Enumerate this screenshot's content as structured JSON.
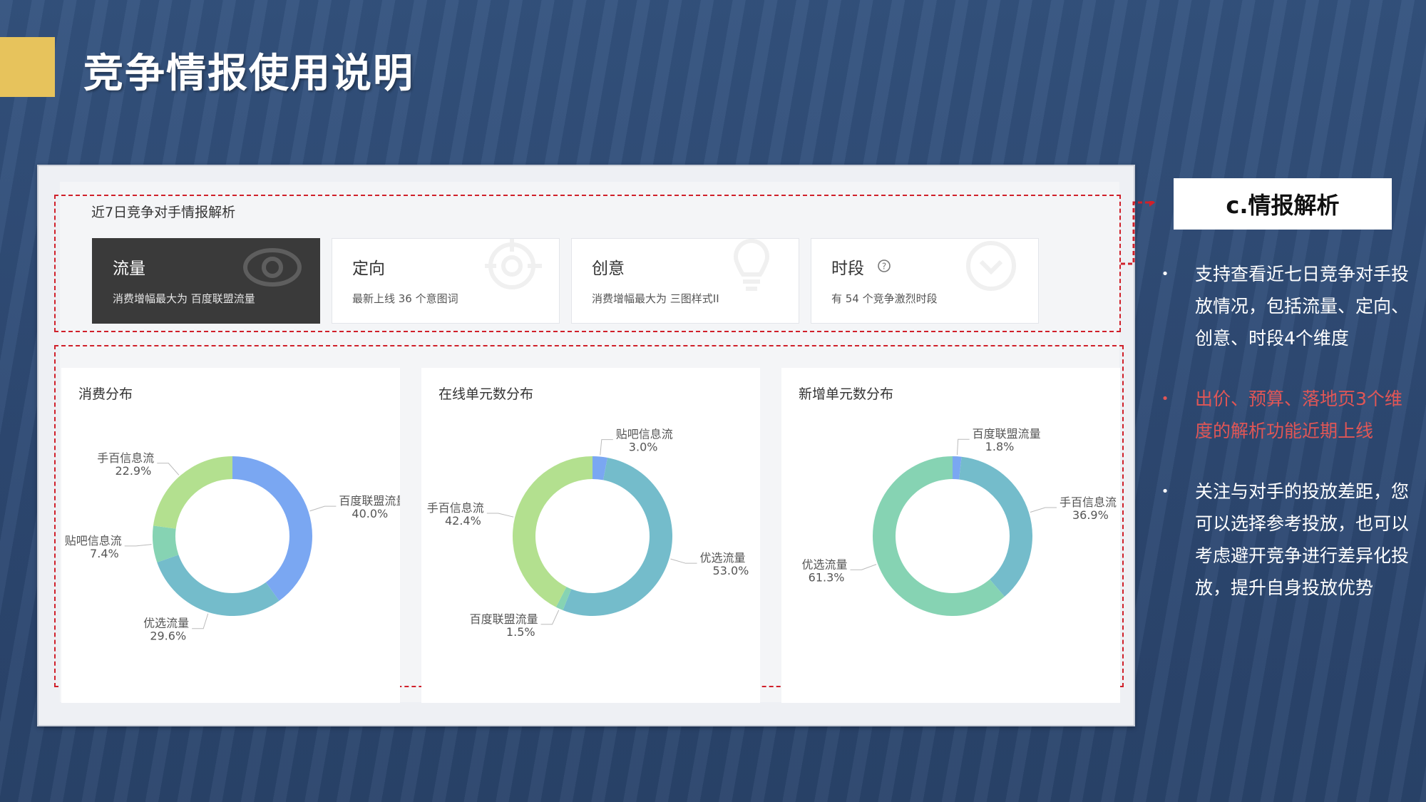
{
  "slide": {
    "title": "竞争情报使用说明",
    "accent_color": "#e7c35c",
    "background_color": "#2f4c78"
  },
  "panel": {
    "section_title": "近7日竞争对手情报解析",
    "highlight_color": "#d0202a",
    "tabs": [
      {
        "label": "流量",
        "desc": "消费增幅最大为 百度联盟流量",
        "active": true,
        "icon": "eye-icon"
      },
      {
        "label": "定向",
        "desc": "最新上线 36 个意图词",
        "active": false,
        "icon": "target-icon"
      },
      {
        "label": "创意",
        "desc": "消费增幅最大为 三图样式II",
        "active": false,
        "icon": "lightbulb-icon"
      },
      {
        "label": "时段",
        "desc": "有 54 个竞争激烈时段",
        "active": false,
        "icon": "clock-icon",
        "help_icon": "question-circle-icon"
      }
    ]
  },
  "chart_data": [
    {
      "type": "pie",
      "title": "消费分布",
      "slices": [
        {
          "label": "百度联盟流量",
          "value": 40.0,
          "text": "40.0%",
          "color": "#7aa7f2"
        },
        {
          "label": "优选流量",
          "value": 29.6,
          "text": "29.6%",
          "color": "#74bccb"
        },
        {
          "label": "贴吧信息流",
          "value": 7.4,
          "text": "7.4%",
          "color": "#86d3b3"
        },
        {
          "label": "手百信息流",
          "value": 22.9,
          "text": "22.9%",
          "color": "#b3e08f"
        }
      ]
    },
    {
      "type": "pie",
      "title": "在线单元数分布",
      "slices": [
        {
          "label": "贴吧信息流",
          "value": 3.0,
          "text": "3.0%",
          "color": "#7aa7f2"
        },
        {
          "label": "优选流量",
          "value": 53.0,
          "text": "53.0%",
          "color": "#74bccb"
        },
        {
          "label": "百度联盟流量",
          "value": 1.5,
          "text": "1.5%",
          "color": "#86d3b3"
        },
        {
          "label": "手百信息流",
          "value": 42.4,
          "text": "42.4%",
          "color": "#b3e08f"
        }
      ]
    },
    {
      "type": "pie",
      "title": "新增单元数分布",
      "slices": [
        {
          "label": "百度联盟流量",
          "value": 1.8,
          "text": "1.8%",
          "color": "#7aa7f2"
        },
        {
          "label": "手百信息流",
          "value": 36.9,
          "text": "36.9%",
          "color": "#74bccb"
        },
        {
          "label": "优选流量",
          "value": 61.3,
          "text": "61.3%",
          "color": "#86d3b3"
        }
      ]
    }
  ],
  "side": {
    "label": "c.情报解析",
    "bullets": [
      {
        "text": "支持查看近七日竞争对手投放情况，包括流量、定向、创意、时段4个维度",
        "color": "white"
      },
      {
        "text": "出价、预算、落地页3个维度的解析功能近期上线",
        "color": "red"
      },
      {
        "text": "关注与对手的投放差距，您可以选择参考投放，也可以考虑避开竞争进行差异化投放，提升自身投放优势",
        "color": "white"
      }
    ]
  }
}
